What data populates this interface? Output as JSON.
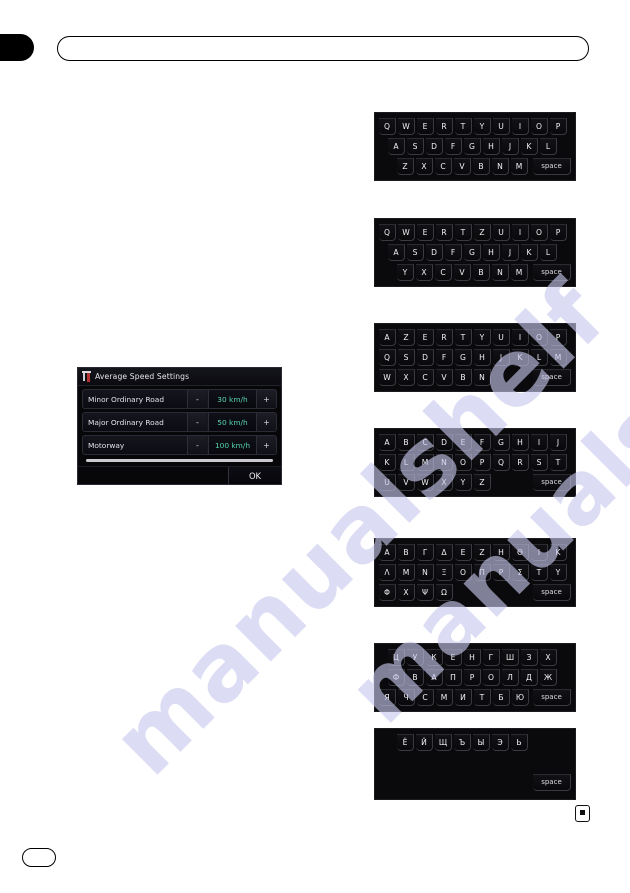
{
  "page": {
    "marker_icon": "page-marker-icon",
    "watermark_lines": [
      "manualshelf",
      "manualshelf"
    ]
  },
  "dialog": {
    "title": "Average Speed Settings",
    "title_icon": "speed-gauge-icon",
    "minus_label": "-",
    "plus_label": "+",
    "ok_label": "OK",
    "rows": [
      {
        "label": "Minor Ordinary Road",
        "value": "30 km/h"
      },
      {
        "label": "Major Ordinary Road",
        "value": "50 km/h"
      },
      {
        "label": "Motorway",
        "value": "100 km/h"
      }
    ],
    "value_color": "#57d6ae"
  },
  "keyboards": [
    {
      "name": "qwerty",
      "rows": [
        {
          "align": "left",
          "keys": [
            "Q",
            "W",
            "E",
            "R",
            "T",
            "Y",
            "U",
            "I",
            "O",
            "P"
          ]
        },
        {
          "align": "indent",
          "keys": [
            "A",
            "S",
            "D",
            "F",
            "G",
            "H",
            "J",
            "K",
            "L"
          ]
        },
        {
          "align": "indent2",
          "keys": [
            "Z",
            "X",
            "C",
            "V",
            "B",
            "N",
            "M"
          ],
          "space": "space"
        }
      ]
    },
    {
      "name": "qwertz",
      "rows": [
        {
          "align": "left",
          "keys": [
            "Q",
            "W",
            "E",
            "R",
            "T",
            "Z",
            "U",
            "I",
            "O",
            "P"
          ]
        },
        {
          "align": "indent",
          "keys": [
            "A",
            "S",
            "D",
            "F",
            "G",
            "H",
            "J",
            "K",
            "L"
          ]
        },
        {
          "align": "indent2",
          "keys": [
            "Y",
            "X",
            "C",
            "V",
            "B",
            "N",
            "M"
          ],
          "space": "space"
        }
      ]
    },
    {
      "name": "azerty",
      "rows": [
        {
          "align": "left",
          "keys": [
            "A",
            "Z",
            "E",
            "R",
            "T",
            "Y",
            "U",
            "I",
            "O",
            "P"
          ]
        },
        {
          "align": "left",
          "keys": [
            "Q",
            "S",
            "D",
            "F",
            "G",
            "H",
            "J",
            "K",
            "L",
            "M"
          ]
        },
        {
          "align": "left",
          "keys": [
            "W",
            "X",
            "C",
            "V",
            "B",
            "N"
          ],
          "space": "space"
        }
      ]
    },
    {
      "name": "abc",
      "rows": [
        {
          "align": "left",
          "keys": [
            "A",
            "B",
            "C",
            "D",
            "E",
            "F",
            "G",
            "H",
            "I",
            "J"
          ]
        },
        {
          "align": "left",
          "keys": [
            "K",
            "L",
            "M",
            "N",
            "O",
            "P",
            "Q",
            "R",
            "S",
            "T"
          ]
        },
        {
          "align": "left",
          "keys": [
            "U",
            "V",
            "W",
            "X",
            "Y",
            "Z"
          ],
          "space": "space"
        }
      ]
    },
    {
      "name": "greek",
      "rows": [
        {
          "align": "left",
          "keys": [
            "Α",
            "Β",
            "Γ",
            "Δ",
            "Ε",
            "Ζ",
            "Η",
            "Θ",
            "Ι",
            "Κ"
          ]
        },
        {
          "align": "left",
          "keys": [
            "Λ",
            "Μ",
            "Ν",
            "Ξ",
            "Ο",
            "Π",
            "Ρ",
            "Σ",
            "Τ",
            "Υ"
          ]
        },
        {
          "align": "left",
          "keys": [
            "Φ",
            "Χ",
            "Ψ",
            "Ω"
          ],
          "space": "space"
        }
      ]
    },
    {
      "name": "cyrillic-1",
      "rows": [
        {
          "align": "indent",
          "keys": [
            "Ц",
            "У",
            "К",
            "Е",
            "Н",
            "Г",
            "Ш",
            "З",
            "Х"
          ]
        },
        {
          "align": "indent",
          "keys": [
            "Ф",
            "В",
            "А",
            "П",
            "Р",
            "О",
            "Л",
            "Д",
            "Ж"
          ]
        },
        {
          "align": "left",
          "keys": [
            "Я",
            "Ч",
            "С",
            "М",
            "И",
            "Т",
            "Б",
            "Ю"
          ],
          "space": "space"
        }
      ]
    },
    {
      "name": "cyrillic-2",
      "rows": [
        {
          "align": "indent2",
          "keys": [
            "Ё",
            "Й",
            "Щ",
            "Ъ",
            "Ы",
            "Э",
            "Ь"
          ]
        },
        {
          "align": "left",
          "keys": []
        },
        {
          "align": "left",
          "keys": [],
          "space": "space"
        }
      ]
    }
  ]
}
